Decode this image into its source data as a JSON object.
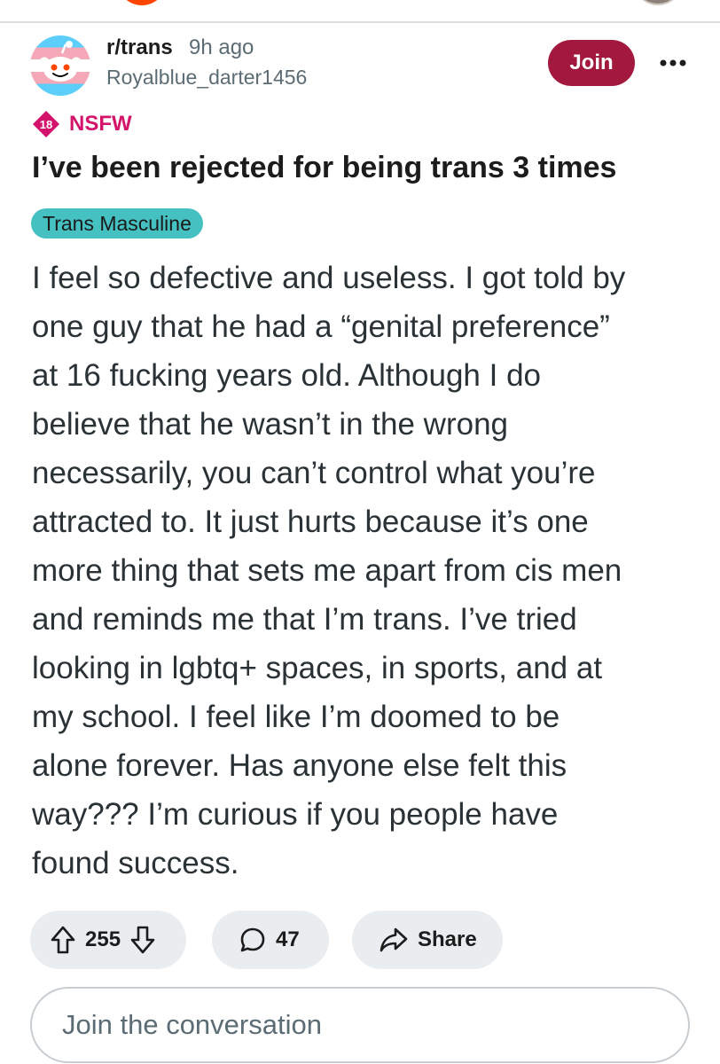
{
  "header": {
    "subreddit": "r/trans",
    "time_ago": "9h ago",
    "username": "Royalblue_darter1456",
    "join_label": "Join",
    "more_icon": "more-dots-icon"
  },
  "post": {
    "nsfw_badge": "18",
    "nsfw_label": "NSFW",
    "title": "I’ve been rejected for being trans 3 times",
    "flair": "Trans Masculine",
    "body_lines": [
      "I feel so defective and useless. I got told by",
      "one guy that he had a “genital preference”",
      "at 16 fucking years old. Although I do",
      "believe that he wasn’t in the wrong",
      "necessarily, you can’t control what you’re",
      "attracted to. It just hurts because it’s one",
      "more thing that sets me apart from cis men",
      "and reminds me that I’m trans. I’ve tried",
      "looking in lgbtq+ spaces, in sports, and at",
      "my school. I feel like I’m doomed to be",
      "alone forever. Has anyone else felt this",
      "way??? I’m curious if you people have",
      "found success."
    ]
  },
  "actions": {
    "upvotes": "255",
    "comments": "47",
    "share_label": "Share"
  },
  "comment_box": {
    "placeholder": "Join the conversation"
  },
  "colors": {
    "join_button": "#a3193d",
    "nsfw": "#d4136a",
    "flair_bg": "#46c1c1",
    "pill_bg": "#eaedef"
  }
}
